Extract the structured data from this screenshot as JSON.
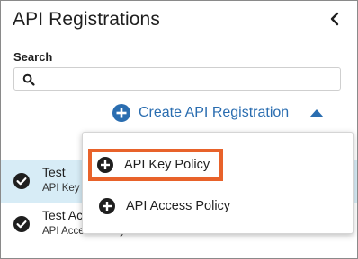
{
  "header": {
    "title": "API Registrations"
  },
  "search": {
    "label": "Search",
    "value": "",
    "placeholder": ""
  },
  "create": {
    "label": "Create API Registration"
  },
  "list": {
    "items": [
      {
        "title": "Test",
        "subtitle": "API Key Policy",
        "selected": true
      },
      {
        "title": "Test Access",
        "subtitle": "API Access Policy",
        "selected": false
      }
    ]
  },
  "menu": {
    "items": [
      {
        "label": "API Key Policy",
        "highlighted": true
      },
      {
        "label": "API Access Policy",
        "highlighted": false
      }
    ]
  },
  "colors": {
    "accent": "#2a6db0",
    "highlight_border": "#e8622a",
    "selected_row": "#d7ecf6"
  }
}
